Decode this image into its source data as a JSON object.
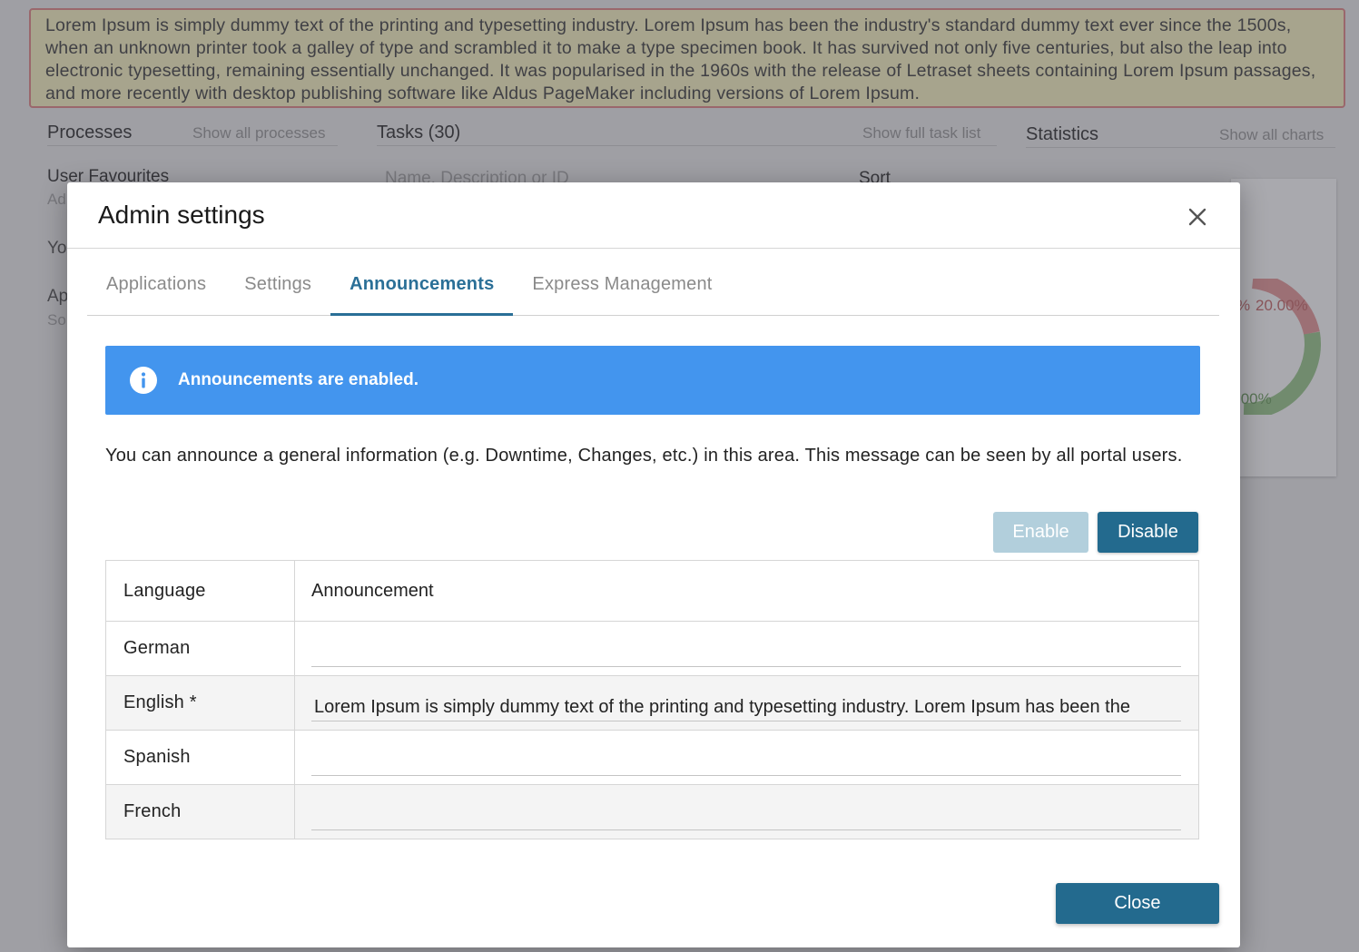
{
  "background": {
    "announcement_text": "Lorem Ipsum is simply dummy text of the printing and typesetting industry. Lorem Ipsum has been the industry's standard dummy text ever since the 1500s, when an unknown printer took a galley of type and scrambled it to make a type specimen book. It has survived not only five centuries, but also the leap into electronic typesetting, remaining essentially unchanged. It was popularised in the 1960s with the release of Letraset sheets containing Lorem Ipsum passages, and more recently with desktop publishing software like Aldus PageMaker including versions of Lorem Ipsum.",
    "processes_title": "Processes",
    "processes_link": "Show all processes",
    "tasks_title": "Tasks (30)",
    "tasks_link": "Show full task list",
    "statistics_title": "Statistics",
    "statistics_link": "Show all charts",
    "user_favourites": "User Favourites",
    "search_placeholder": "Name, Description or ID",
    "sort_label": "Sort",
    "fragment_ad": "Ad",
    "fragment_yo": "Yo",
    "fragment_ap": "Ap",
    "fragment_so": "So",
    "pct_top_left": "%",
    "pct_red": "20.00%",
    "pct_green": ".00%",
    "colors": {
      "red_slice": "#e89a9a",
      "green_slice": "#9bc98e"
    }
  },
  "modal": {
    "title": "Admin settings",
    "close_icon": "close-icon",
    "tabs": [
      {
        "label": "Applications",
        "active": false
      },
      {
        "label": "Settings",
        "active": false
      },
      {
        "label": "Announcements",
        "active": true
      },
      {
        "label": "Express Management",
        "active": false
      }
    ],
    "info_icon": "info-circle-icon",
    "info_text": "Announcements are enabled.",
    "description": "You can announce a general information (e.g. Downtime, Changes, etc.) in this area. This message can be seen by all portal users.",
    "enable_label": "Enable",
    "disable_label": "Disable",
    "table": {
      "col_language": "Language",
      "col_announcement": "Announcement",
      "rows": [
        {
          "language": "German",
          "value": ""
        },
        {
          "language": "English  *",
          "value": "Lorem Ipsum is simply dummy text of the printing and typesetting industry. Lorem Ipsum has been the"
        },
        {
          "language": "Spanish",
          "value": ""
        },
        {
          "language": "French",
          "value": ""
        }
      ]
    },
    "close_label": "Close",
    "colors": {
      "accent": "#2a6f97",
      "info_bar": "#4395ee",
      "enable_disabled": "#b2cfdc",
      "primary": "#236a8e"
    }
  }
}
